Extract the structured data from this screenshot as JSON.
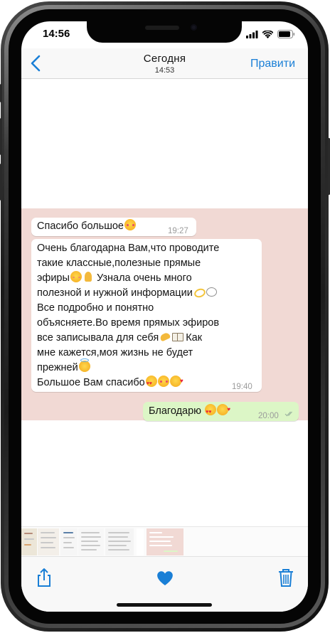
{
  "status_bar": {
    "time": "14:56"
  },
  "nav": {
    "title": "Сегодня",
    "subtitle": "14:53",
    "edit_label": "Правити"
  },
  "colors": {
    "accent": "#1a7fd6",
    "chat_background": "#f1d9d4",
    "outgoing_bubble": "#dcf6c6"
  },
  "messages": [
    {
      "direction": "incoming",
      "text": "Спасибо большое",
      "emojis": [
        "smiling-face-with-hearts"
      ],
      "time": "19:27"
    },
    {
      "direction": "incoming",
      "lines": [
        "Очень благодарна Вам,что проводите",
        "такие классные,полезные прямые",
        "эфиры",
        "Узнала очень много",
        "полезной и нужной информации",
        "Все подробно и понятно",
        "объясняете.Во время прямых эфиров",
        "все записывала для себя",
        "Как",
        "мне кажется,моя жизнь не будет",
        "прежней",
        "Большое Вам спасибо"
      ],
      "time": "19:40"
    },
    {
      "direction": "outgoing",
      "text": "Благодарю",
      "time": "20:00"
    }
  ],
  "toolbar": {
    "share": "share-icon",
    "favorite": "heart-icon",
    "delete": "trash-icon"
  }
}
